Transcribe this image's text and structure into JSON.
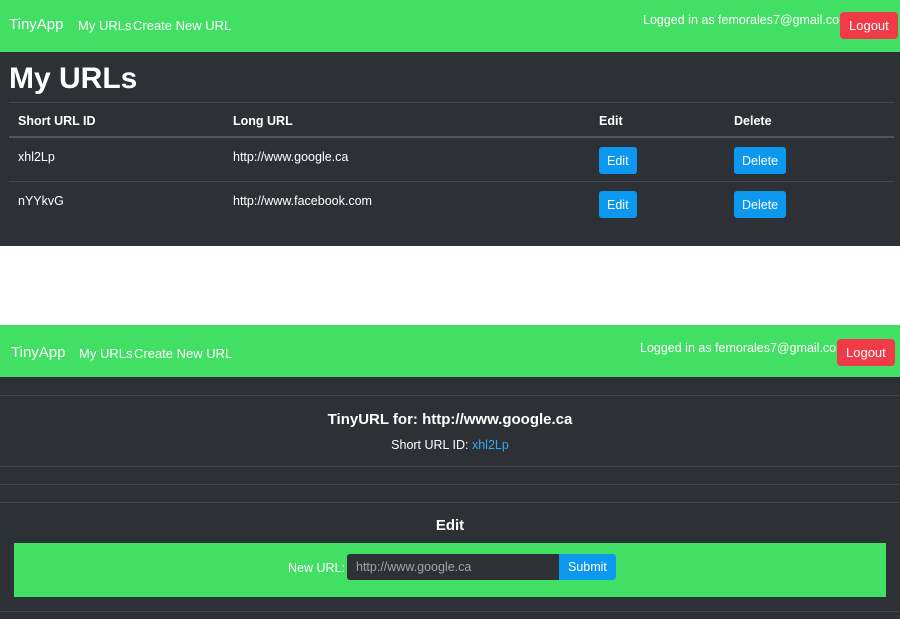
{
  "colors": {
    "navbar": "#41df63",
    "panel_bg": "#2d3034",
    "logout": "#f03a47",
    "primary_button": "#0d98f0",
    "link": "#35a9f0"
  },
  "nav": {
    "brand": "TinyApp",
    "links": [
      "My URLs",
      "Create New URL"
    ],
    "logged_in": "Logged in as femorales7@gmail.com",
    "logout": "Logout"
  },
  "urls_page": {
    "title": "My URLs",
    "columns": [
      "Short URL ID",
      "Long URL",
      "Edit",
      "Delete"
    ],
    "rows": [
      {
        "short_id": "xhl2Lp",
        "long_url": "http://www.google.ca",
        "edit": "Edit",
        "delete": "Delete"
      },
      {
        "short_id": "nYYkvG",
        "long_url": "http://www.facebook.com",
        "edit": "Edit",
        "delete": "Delete"
      }
    ]
  },
  "detail_page": {
    "tiny_title": "TinyURL for: http://www.google.ca",
    "short_id_label": "Short URL ID:",
    "short_id_value": "xhl2Lp",
    "edit_heading": "Edit",
    "form": {
      "label": "New URL:",
      "placeholder": "http://www.google.ca",
      "submit": "Submit"
    }
  }
}
